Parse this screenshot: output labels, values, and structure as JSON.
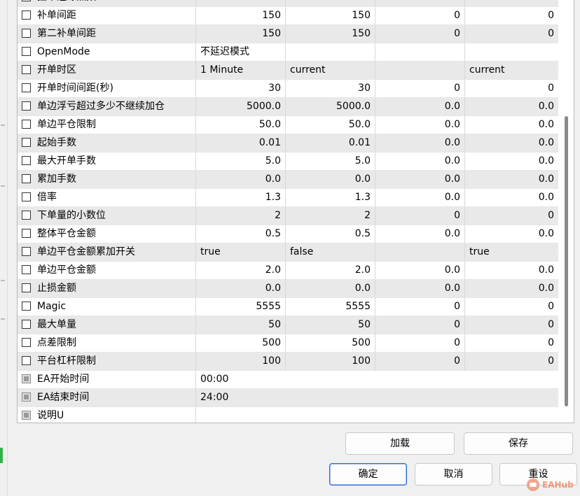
{
  "rows": [
    {
      "name": "挂单追踪点数",
      "v1": "",
      "v2": "",
      "v3": "",
      "v4": "",
      "type": "num",
      "alt": true
    },
    {
      "name": "补单间距",
      "v1": "150",
      "v2": "150",
      "v3": "0",
      "v4": "0",
      "type": "num",
      "alt": false
    },
    {
      "name": "第二补单间距",
      "v1": "150",
      "v2": "150",
      "v3": "0",
      "v4": "0",
      "type": "num",
      "alt": true
    },
    {
      "name": "OpenMode",
      "v1": "不延迟模式",
      "v2": "",
      "v3": "",
      "v4": "",
      "type": "txt",
      "alt": false
    },
    {
      "name": "开单时区",
      "v1": "1 Minute",
      "v2": "current",
      "v3": "",
      "v4": "current",
      "type": "txt",
      "alt": true
    },
    {
      "name": "开单时间间距(秒)",
      "v1": "30",
      "v2": "30",
      "v3": "0",
      "v4": "0",
      "type": "num",
      "alt": false
    },
    {
      "name": "单边浮亏超过多少不继续加仓",
      "v1": "5000.0",
      "v2": "5000.0",
      "v3": "0.0",
      "v4": "0.0",
      "type": "num",
      "alt": true
    },
    {
      "name": "单边平仓限制",
      "v1": "50.0",
      "v2": "50.0",
      "v3": "0.0",
      "v4": "0.0",
      "type": "num",
      "alt": false
    },
    {
      "name": "起始手数",
      "v1": "0.01",
      "v2": "0.01",
      "v3": "0.0",
      "v4": "0.0",
      "type": "num",
      "alt": true
    },
    {
      "name": "最大开单手数",
      "v1": "5.0",
      "v2": "5.0",
      "v3": "0.0",
      "v4": "0.0",
      "type": "num",
      "alt": false
    },
    {
      "name": "累加手数",
      "v1": "0.0",
      "v2": "0.0",
      "v3": "0.0",
      "v4": "0.0",
      "type": "num",
      "alt": true
    },
    {
      "name": "倍率",
      "v1": "1.3",
      "v2": "1.3",
      "v3": "0.0",
      "v4": "0.0",
      "type": "num",
      "alt": false
    },
    {
      "name": "下单量的小数位",
      "v1": "2",
      "v2": "2",
      "v3": "0",
      "v4": "0",
      "type": "num",
      "alt": true
    },
    {
      "name": "整体平仓金额",
      "v1": "0.5",
      "v2": "0.5",
      "v3": "0.0",
      "v4": "0.0",
      "type": "num",
      "alt": false
    },
    {
      "name": "单边平仓金额累加开关",
      "v1": "true",
      "v2": "false",
      "v3": "",
      "v4": "true",
      "type": "txt",
      "alt": true
    },
    {
      "name": "单边平仓金额",
      "v1": "2.0",
      "v2": "2.0",
      "v3": "0.0",
      "v4": "0.0",
      "type": "num",
      "alt": false
    },
    {
      "name": "止损金额",
      "v1": "0.0",
      "v2": "0.0",
      "v3": "0.0",
      "v4": "0.0",
      "type": "num",
      "alt": true
    },
    {
      "name": "Magic",
      "v1": "5555",
      "v2": "5555",
      "v3": "0",
      "v4": "0",
      "type": "num",
      "alt": false
    },
    {
      "name": "最大单量",
      "v1": "50",
      "v2": "50",
      "v3": "0",
      "v4": "0",
      "type": "num",
      "alt": true
    },
    {
      "name": "点差限制",
      "v1": "500",
      "v2": "500",
      "v3": "0",
      "v4": "0",
      "type": "num",
      "alt": false
    },
    {
      "name": "平台杠杆限制",
      "v1": "100",
      "v2": "100",
      "v3": "0",
      "v4": "0",
      "type": "num",
      "alt": true
    },
    {
      "name": "EA开始时间",
      "v1": "00:00",
      "type": "wide",
      "alt": false,
      "disabled": true
    },
    {
      "name": "EA结束时间",
      "v1": "24:00",
      "type": "wide",
      "alt": true,
      "disabled": true
    },
    {
      "name": "说明U",
      "v1": "",
      "type": "wide",
      "alt": false,
      "disabled": true
    }
  ],
  "buttons": {
    "load": "加载",
    "save": "保存",
    "ok": "确定",
    "cancel": "取消",
    "reset": "重设"
  },
  "watermark": "EAHub",
  "colors": {
    "accent": "#2a6ad0",
    "row_alt": "#e9e9e9",
    "watermark": "#f07a55"
  }
}
